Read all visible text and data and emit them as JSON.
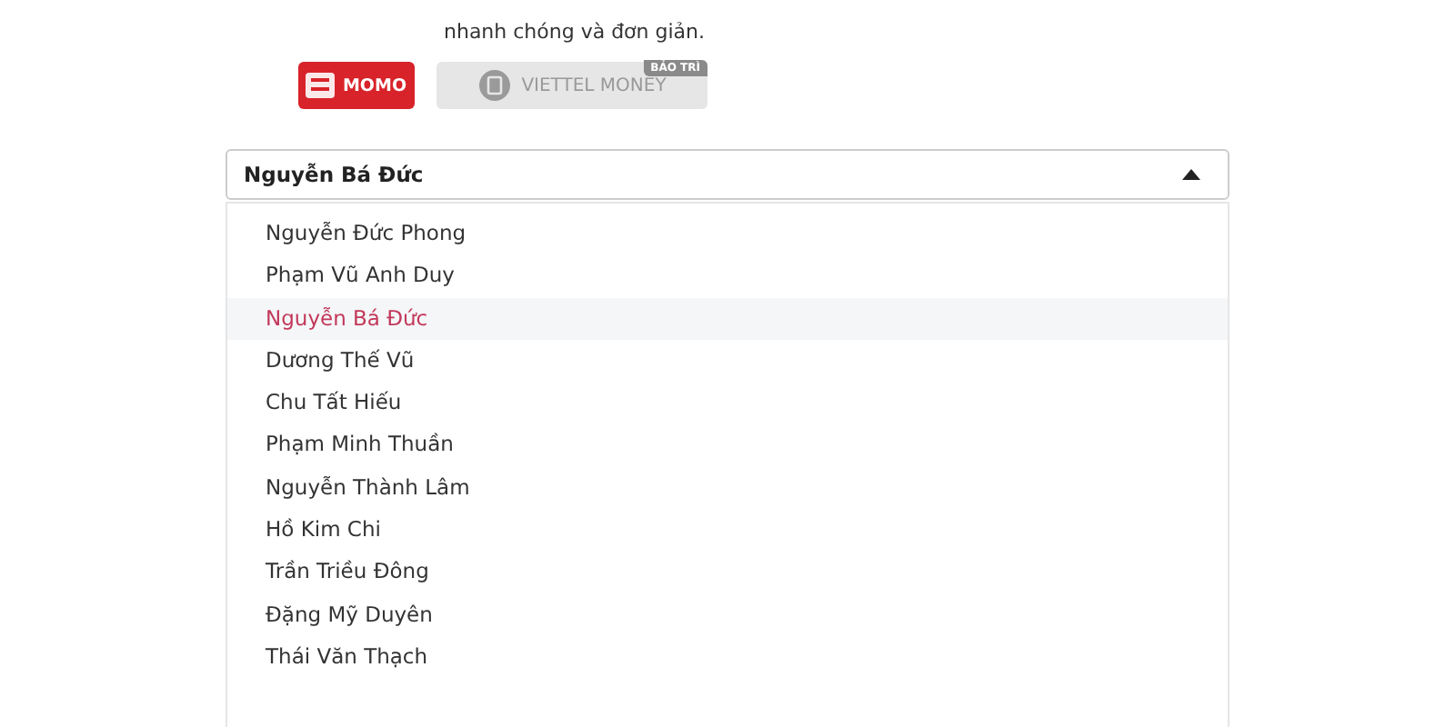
{
  "intro": "nhanh chóng và đơn giản.",
  "wallets": [
    {
      "kind": "momo",
      "label": "MOMO",
      "selected": true
    },
    {
      "kind": "viettel",
      "label": "VIETTEL MONEY",
      "selected": false,
      "badge": "BẢO TRÌ"
    }
  ],
  "select": {
    "value": "Nguyễn Bá Đức",
    "expanded": true
  },
  "options": [
    {
      "label": "Nguyễn Đức Phong",
      "selected": false
    },
    {
      "label": "Phạm Vũ Anh Duy",
      "selected": false
    },
    {
      "label": "Nguyễn Bá Đức",
      "selected": true
    },
    {
      "label": "Dương Thế Vũ",
      "selected": false
    },
    {
      "label": "Chu Tất Hiếu",
      "selected": false
    },
    {
      "label": "Phạm Minh Thuần",
      "selected": false
    },
    {
      "label": "Nguyễn Thành Lâm",
      "selected": false
    },
    {
      "label": "Hồ Kim Chi",
      "selected": false
    },
    {
      "label": "Trần Triều Đông",
      "selected": false
    },
    {
      "label": "Đặng Mỹ Duyên",
      "selected": false
    },
    {
      "label": "Thái Văn Thạch",
      "selected": false
    }
  ]
}
